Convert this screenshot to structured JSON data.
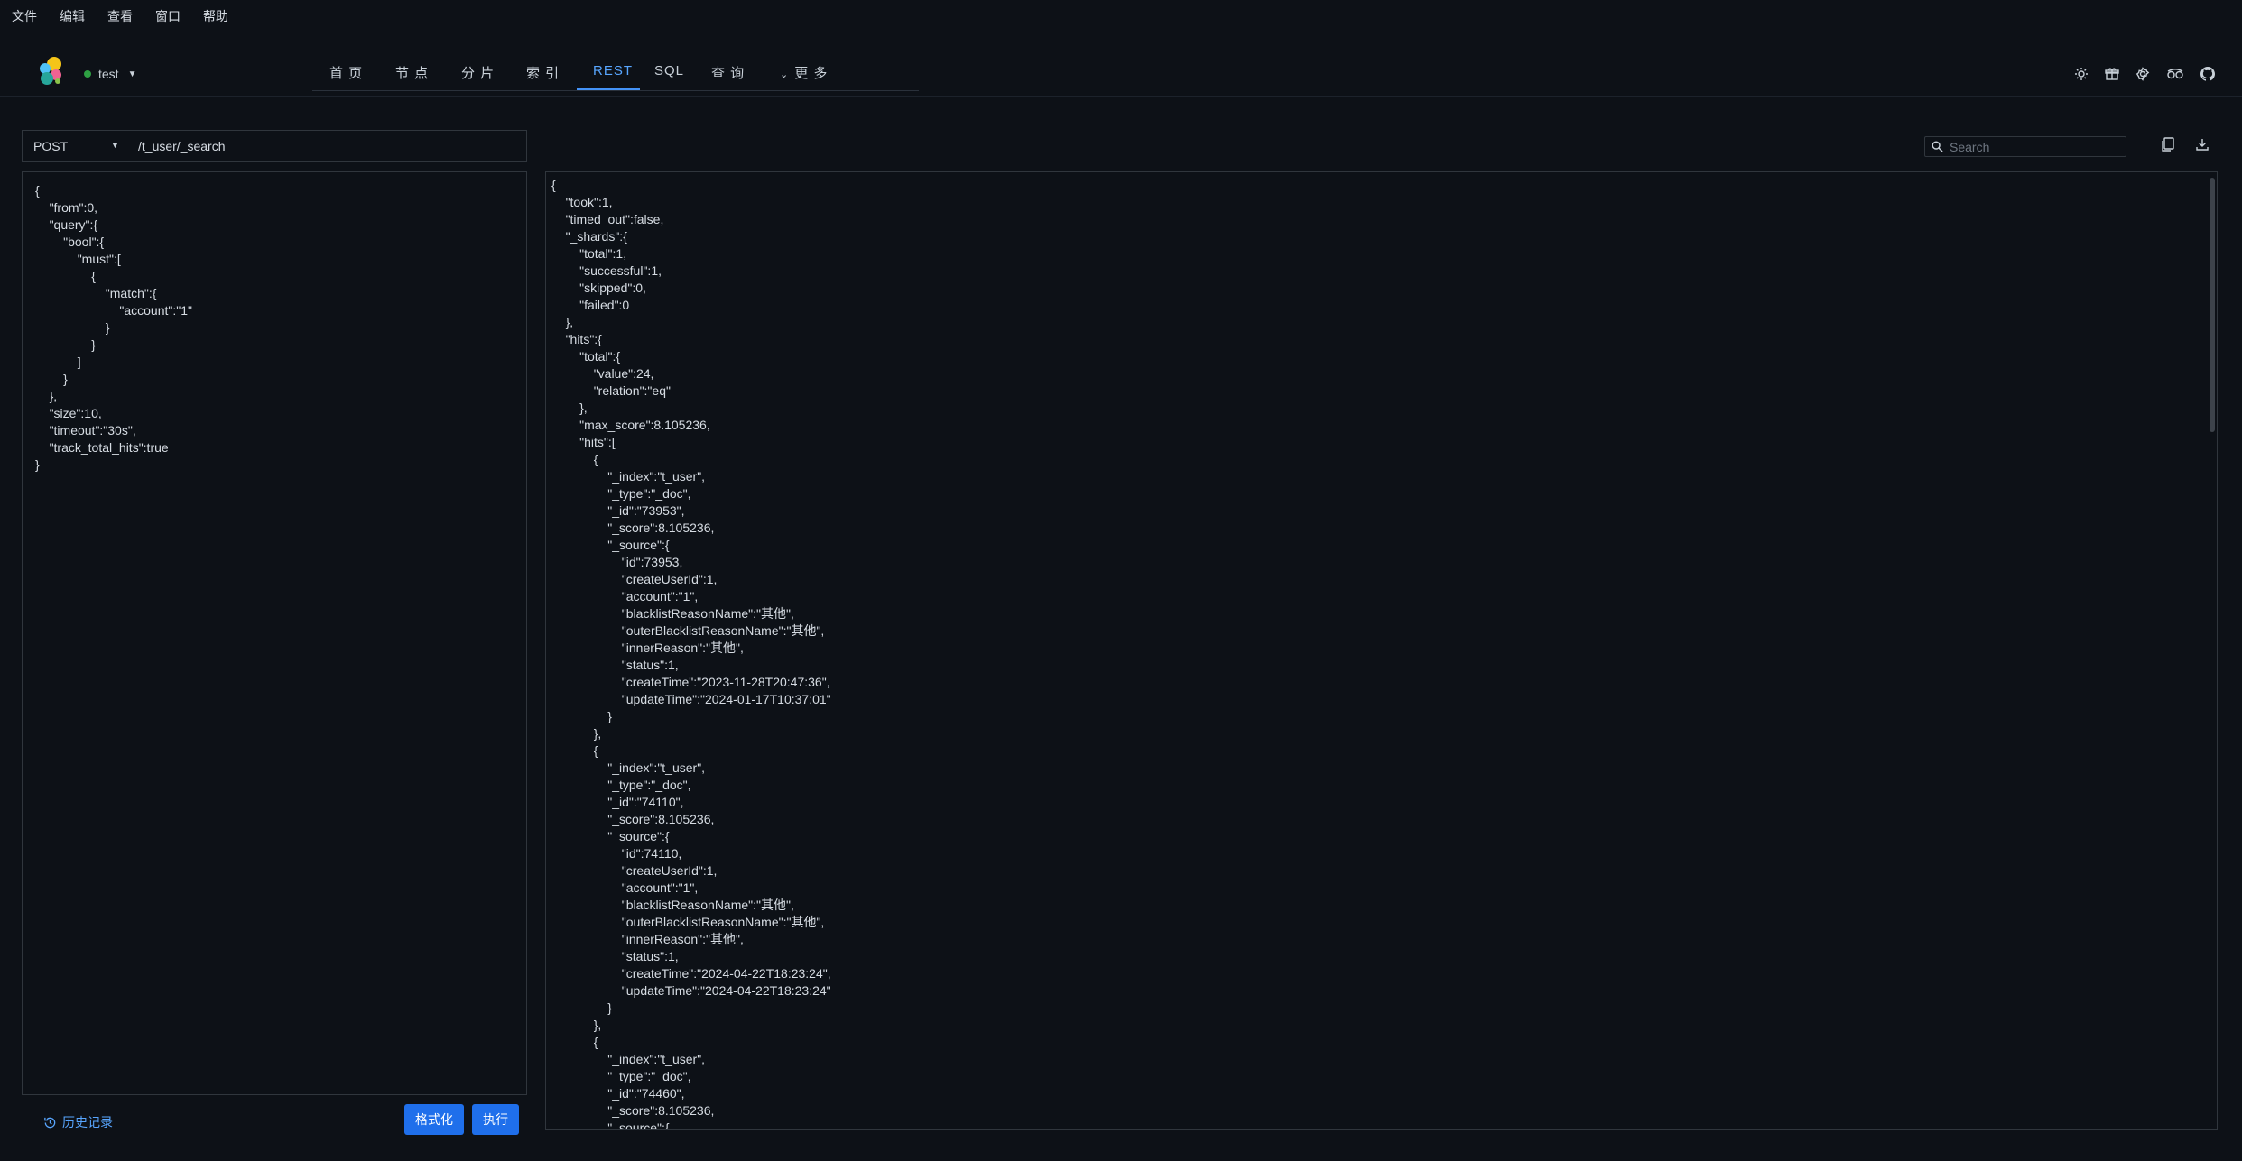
{
  "menubar": {
    "items": [
      "文件",
      "编辑",
      "查看",
      "窗口",
      "帮助"
    ]
  },
  "header": {
    "cluster_name": "test",
    "cluster_status_color": "#2ea043",
    "tabs": [
      "首 页",
      "节 点",
      "分 片",
      "索 引",
      "REST",
      "SQL",
      "查 询",
      "更 多"
    ],
    "active_tab": "REST",
    "tools": [
      "sun-icon",
      "gift-icon",
      "gear-icon",
      "tripadvisor-icon",
      "github-icon"
    ]
  },
  "request": {
    "method": "POST",
    "path": "/t_user/_search",
    "body": "{\n\t\"from\":0,\n\t\"query\":{\n\t\t\"bool\":{\n\t\t\t\"must\":[\n\t\t\t\t{\n\t\t\t\t\t\"match\":{\n\t\t\t\t\t\t\"account\":\"1\"\n\t\t\t\t\t}\n\t\t\t\t}\n\t\t\t]\n\t\t}\n\t},\n\t\"size\":10,\n\t\"timeout\":\"30s\",\n\t\"track_total_hits\":true\n}"
  },
  "footer": {
    "history_label": "历史记录",
    "format_label": "格式化",
    "execute_label": "执行"
  },
  "response": {
    "search_placeholder": "Search",
    "body": "{\n\t\"took\":1,\n\t\"timed_out\":false,\n\t\"_shards\":{\n\t\t\"total\":1,\n\t\t\"successful\":1,\n\t\t\"skipped\":0,\n\t\t\"failed\":0\n\t},\n\t\"hits\":{\n\t\t\"total\":{\n\t\t\t\"value\":24,\n\t\t\t\"relation\":\"eq\"\n\t\t},\n\t\t\"max_score\":8.105236,\n\t\t\"hits\":[\n\t\t\t{\n\t\t\t\t\"_index\":\"t_user\",\n\t\t\t\t\"_type\":\"_doc\",\n\t\t\t\t\"_id\":\"73953\",\n\t\t\t\t\"_score\":8.105236,\n\t\t\t\t\"_source\":{\n\t\t\t\t\t\"id\":73953,\n\t\t\t\t\t\"createUserId\":1,\n\t\t\t\t\t\"account\":\"1\",\n\t\t\t\t\t\"blacklistReasonName\":\"其他\",\n\t\t\t\t\t\"outerBlacklistReasonName\":\"其他\",\n\t\t\t\t\t\"innerReason\":\"其他\",\n\t\t\t\t\t\"status\":1,\n\t\t\t\t\t\"createTime\":\"2023-11-28T20:47:36\",\n\t\t\t\t\t\"updateTime\":\"2024-01-17T10:37:01\"\n\t\t\t\t}\n\t\t\t},\n\t\t\t{\n\t\t\t\t\"_index\":\"t_user\",\n\t\t\t\t\"_type\":\"_doc\",\n\t\t\t\t\"_id\":\"74110\",\n\t\t\t\t\"_score\":8.105236,\n\t\t\t\t\"_source\":{\n\t\t\t\t\t\"id\":74110,\n\t\t\t\t\t\"createUserId\":1,\n\t\t\t\t\t\"account\":\"1\",\n\t\t\t\t\t\"blacklistReasonName\":\"其他\",\n\t\t\t\t\t\"outerBlacklistReasonName\":\"其他\",\n\t\t\t\t\t\"innerReason\":\"其他\",\n\t\t\t\t\t\"status\":1,\n\t\t\t\t\t\"createTime\":\"2024-04-22T18:23:24\",\n\t\t\t\t\t\"updateTime\":\"2024-04-22T18:23:24\"\n\t\t\t\t}\n\t\t\t},\n\t\t\t{\n\t\t\t\t\"_index\":\"t_user\",\n\t\t\t\t\"_type\":\"_doc\",\n\t\t\t\t\"_id\":\"74460\",\n\t\t\t\t\"_score\":8.105236,\n\t\t\t\t\"_source\":{"
  },
  "colors": {
    "accent": "#1f6feb",
    "link": "#58a6ff",
    "background": "#0d1117"
  }
}
